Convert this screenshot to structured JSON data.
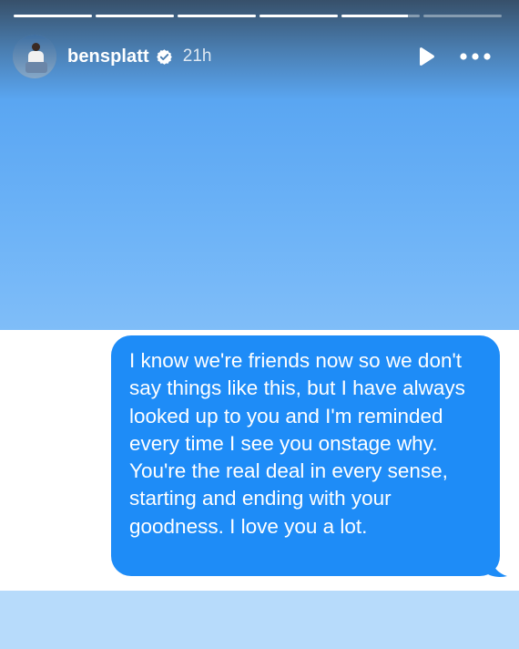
{
  "story": {
    "progress": [
      1,
      1,
      1,
      1,
      0.85,
      0
    ],
    "username": "bensplatt",
    "time_ago": "21h",
    "verified": true
  },
  "icons": {
    "verified": "verified-badge-icon",
    "play": "play-icon",
    "more": "more-options-icon"
  },
  "message": {
    "text": "I know we're friends now so we don't say things like this, but I have always looked up to you and I'm reminded every time I see you onstage why. You're the real deal in every sense, starting and ending with your goodness. I love you a lot."
  },
  "colors": {
    "bubble": "#1e8cf7",
    "background_top": "#5aa6f2",
    "background_bottom": "#b7dbfb"
  }
}
